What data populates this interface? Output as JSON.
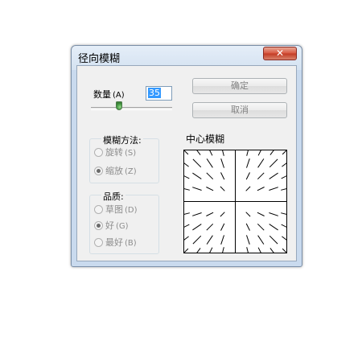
{
  "dialog": {
    "title": "径向模糊",
    "close_glyph": "✕"
  },
  "amount": {
    "label": "数量",
    "shortcut": "(A)",
    "value": "35",
    "slider_fraction": 0.35
  },
  "buttons": {
    "ok": "确定",
    "cancel": "取消"
  },
  "blur_method": {
    "title": "模糊方法:",
    "options": [
      {
        "label": "旋转",
        "shortcut": "(S)",
        "checked": false
      },
      {
        "label": "缩放",
        "shortcut": "(Z)",
        "checked": true
      }
    ]
  },
  "quality": {
    "title": "品质:",
    "options": [
      {
        "label": "草图",
        "shortcut": "(D)",
        "checked": false
      },
      {
        "label": "好",
        "shortcut": "(G)",
        "checked": true
      },
      {
        "label": "最好",
        "shortcut": "(B)",
        "checked": false
      }
    ]
  },
  "center": {
    "title": "中心模糊"
  }
}
